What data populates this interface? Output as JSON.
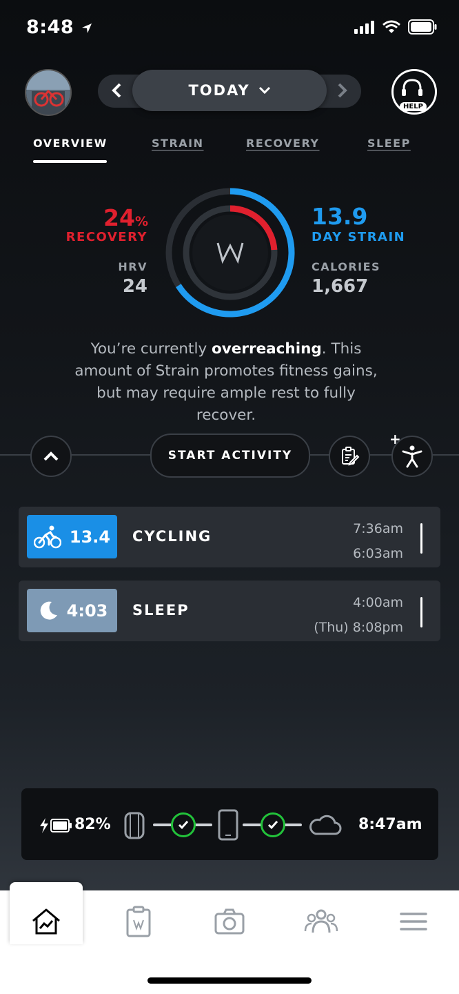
{
  "status_bar": {
    "time": "8:48"
  },
  "header": {
    "date_label": "TODAY",
    "help_label": "HELP"
  },
  "tabs": [
    {
      "label": "OVERVIEW",
      "active": true
    },
    {
      "label": "STRAIN",
      "active": false
    },
    {
      "label": "RECOVERY",
      "active": false
    },
    {
      "label": "SLEEP",
      "active": false
    }
  ],
  "overview": {
    "recovery_value": "24",
    "recovery_unit": "%",
    "recovery_label": "RECOVERY",
    "hrv_label": "HRV",
    "hrv_value": "24",
    "strain_value": "13.9",
    "strain_label": "DAY STRAIN",
    "calories_label": "CALORIES",
    "calories_value": "1,667",
    "ring": {
      "recovery_fraction": 0.24,
      "strain_fraction": 0.66
    },
    "insight_pre": "You’re currently ",
    "insight_bold": "overreaching",
    "insight_post": ". This amount of Strain promotes fitness gains, but may require ample rest to fully recover."
  },
  "actions": {
    "start_activity": "START ACTIVITY",
    "plus": "+"
  },
  "activities": [
    {
      "value": "13.4",
      "title": "CYCLING",
      "end_time": "7:36am",
      "start_time": "6:03am",
      "color": "#1a8fe6",
      "icon": "cycling-icon"
    },
    {
      "value": "4:03",
      "title": "SLEEP",
      "end_time": "4:00am",
      "start_time": "(Thu) 8:08pm",
      "color": "#7e9ab5",
      "icon": "moon-icon"
    }
  ],
  "sync": {
    "battery": "82%",
    "last_sync": "8:47am"
  },
  "colors": {
    "recovery": "#e0202e",
    "strain": "#1f9bf0",
    "sync_ok": "#22c23a"
  }
}
